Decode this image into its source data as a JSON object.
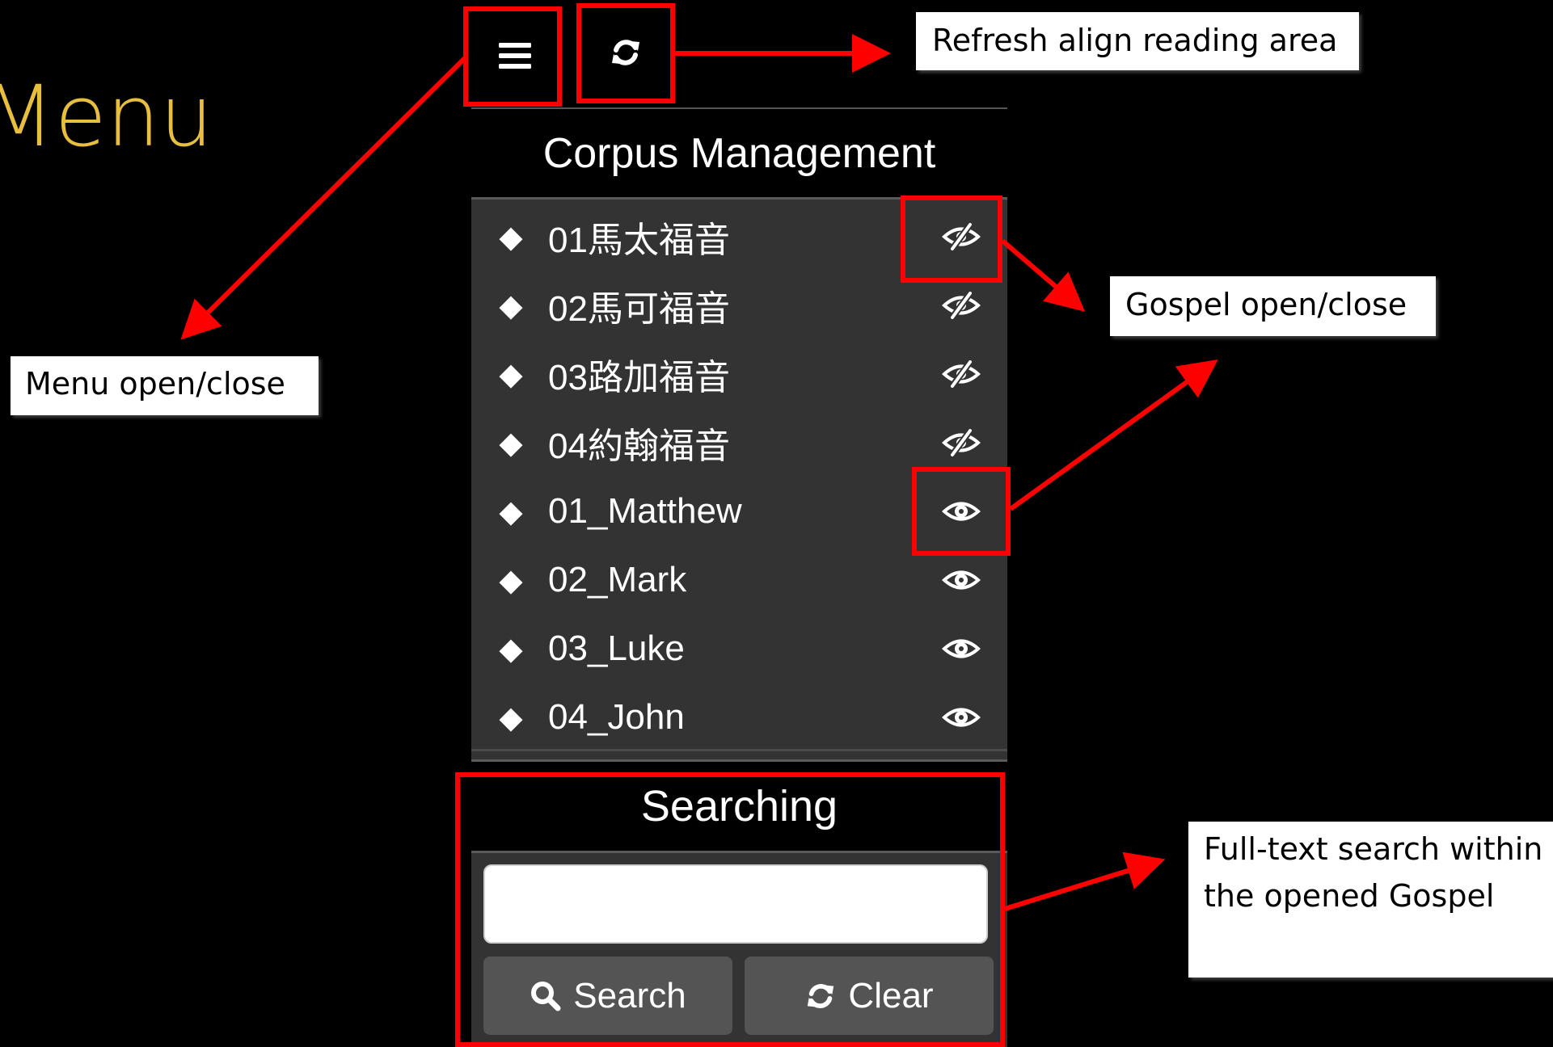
{
  "slide": {
    "title": "Menu"
  },
  "toolbar": {
    "menu_icon": "hamburger-menu-icon",
    "refresh_icon": "refresh-icon"
  },
  "corpus": {
    "header": "Corpus Management",
    "items": [
      {
        "label": "01馬太福音",
        "visibility_icon": "eye-slash-icon"
      },
      {
        "label": "02馬可福音",
        "visibility_icon": "eye-slash-icon"
      },
      {
        "label": "03路加福音",
        "visibility_icon": "eye-slash-icon"
      },
      {
        "label": "04約翰福音",
        "visibility_icon": "eye-slash-icon"
      },
      {
        "label": "01_Matthew",
        "visibility_icon": "eye-icon"
      },
      {
        "label": "02_Mark",
        "visibility_icon": "eye-icon"
      },
      {
        "label": "03_Luke",
        "visibility_icon": "eye-icon"
      },
      {
        "label": "04_John",
        "visibility_icon": "eye-icon"
      }
    ]
  },
  "search": {
    "header": "Searching",
    "input_value": "",
    "search_label": "Search",
    "clear_label": "Clear"
  },
  "callouts": {
    "refresh": "Refresh align reading area",
    "gospel": "Gospel open/close",
    "menu": "Menu open/close",
    "fulltext": "Full-text search within the opened Gospel"
  },
  "colors": {
    "background": "#000000",
    "title": "#E8BE3E",
    "panel": "#333333",
    "highlight": "#FF0000",
    "button": "#545454"
  }
}
